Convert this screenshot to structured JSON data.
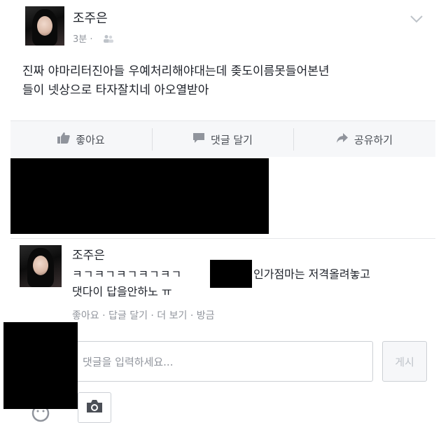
{
  "post": {
    "author": "조주은",
    "time": "3분 ·",
    "text_line1": "진짜 야마리터진아들 우예처리해야대는데 좆도이름못들어본년",
    "text_line2": "들이 넷상으로 타자잘치네 아오열받아"
  },
  "actions": {
    "like": "좋아요",
    "comment": "댓글 달기",
    "share": "공유하기"
  },
  "comment": {
    "author": "조주은",
    "text_part1": "ㅋㄱㅋㄱㅋㄱㅋㄱㅋㄱ",
    "text_part2": "인가점마는 저격올려놓고",
    "text_line2": "댓다이 답을안하노 ㅠ",
    "actions": "좋아요 · 답글 달기 · 더 보기 · 방금"
  },
  "composer": {
    "placeholder": "댓글을 입력하세요...",
    "post_label": "게시"
  },
  "colors": {
    "meta": "#90949c",
    "action_bar": "#f6f7f9",
    "redaction": "#000000"
  },
  "icons": [
    "chevron-down-icon",
    "friends-icon",
    "thumbs-up-icon",
    "comment-icon",
    "share-icon",
    "camera-icon",
    "sticker-icon"
  ]
}
